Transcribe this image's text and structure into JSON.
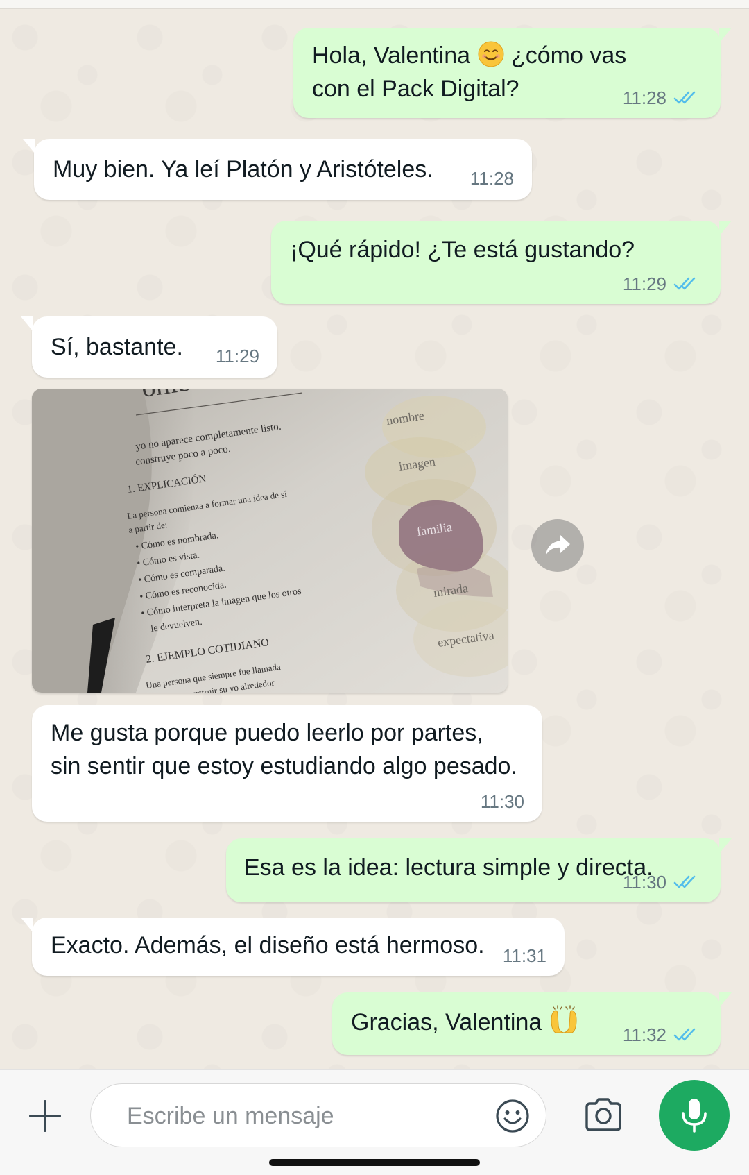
{
  "colors": {
    "outgoing_bubble": "#d9fdd3",
    "incoming_bubble": "#ffffff",
    "read_ticks": "#53bdeb",
    "mic_button": "#1daa61",
    "chat_background": "#efeae2"
  },
  "messages": [
    {
      "direction": "out",
      "line1": "Hola, Valentina",
      "line1b": "¿cómo vas",
      "line2": "con el Pack Digital?",
      "emoji": "smiling-face",
      "time": "11:28",
      "status": "read"
    },
    {
      "direction": "in",
      "text": "Muy bien. Ya leí Platón y Aristóteles.",
      "time": "11:28"
    },
    {
      "direction": "out",
      "text": "¡Qué rápido! ¿Te está gustando?",
      "time": "11:29",
      "status": "read"
    },
    {
      "direction": "in",
      "text": "Sí, bastante.",
      "time": "11:29"
    },
    {
      "direction": "in",
      "type": "image",
      "image": {
        "fragment_top": "ome",
        "lines": [
          "yo no aparece completamente listo.",
          "construye poco a poco."
        ],
        "section1_title": "1. EXPLICACIÓN",
        "section1_intro1": "La persona comienza a formar una idea de sí",
        "section1_intro2": "a partir de:",
        "bullets": [
          "Cómo es nombrada.",
          "Cómo es vista.",
          "Cómo es comparada.",
          "Cómo es reconocida.",
          "Cómo interpreta la imagen que los otros"
        ],
        "bullet_cont": "le devuelven.",
        "section2_title": "2. EJEMPLO COTIDIANO",
        "section2_line1": "Una persona que siempre fue llamada",
        "section2_line2": "... puede construir su yo alrededor",
        "diagram_labels": [
          "nombre",
          "imagen",
          "familia",
          "mirada",
          "expectativa"
        ]
      }
    },
    {
      "direction": "in",
      "line1": "Me gusta porque puedo leerlo por partes,",
      "line2": "sin sentir que estoy estudiando algo pesado.",
      "time": "11:30"
    },
    {
      "direction": "out",
      "text": "Esa es la idea: lectura simple y directa.",
      "time": "11:30",
      "status": "read"
    },
    {
      "direction": "in",
      "text": "Exacto. Además, el diseño está hermoso.",
      "time": "11:31"
    },
    {
      "direction": "out",
      "text": "Gracias, Valentina",
      "emoji": "raising-hands",
      "time": "11:32",
      "status": "read"
    }
  ],
  "input_bar": {
    "placeholder": "Escribe un mensaje",
    "icons": [
      "plus-icon",
      "emoji-icon",
      "camera-icon",
      "microphone-icon"
    ]
  }
}
